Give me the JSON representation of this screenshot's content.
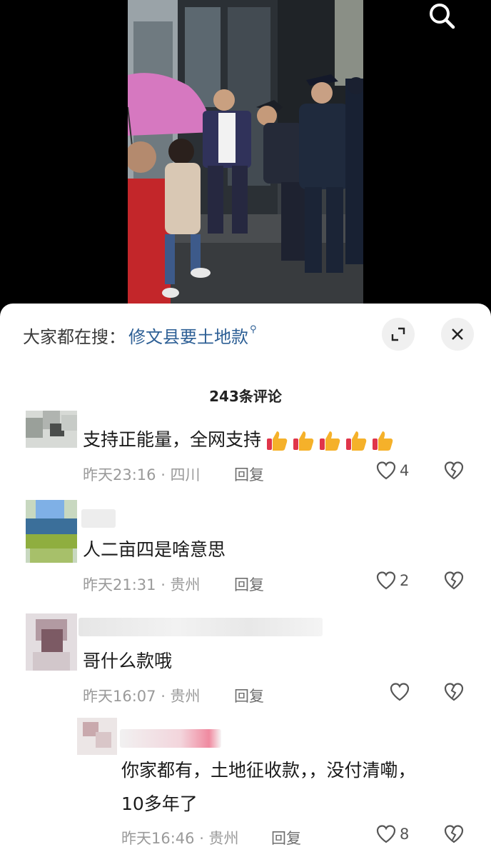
{
  "header": {
    "search_icon": "search-icon"
  },
  "sheet": {
    "search_hint_prefix": "大家都在搜：",
    "search_hint_query": "修文县要土地款",
    "expand_icon": "expand-icon",
    "close_icon": "close-icon",
    "comment_count": "243条评论"
  },
  "comments": [
    {
      "text": "支持正能量，全网支持",
      "emoji": [
        "thumbs-up",
        "thumbs-up",
        "thumbs-up",
        "thumbs-up",
        "thumbs-up"
      ],
      "time": "昨天23:16 · 四川",
      "reply_label": "回复",
      "likes": "4"
    },
    {
      "text": "人二亩四是啥意思",
      "time": "昨天21:31 · 贵州",
      "reply_label": "回复",
      "likes": "2"
    },
    {
      "text": "哥什么款哦",
      "time": "昨天16:07 · 贵州",
      "reply_label": "回复",
      "likes": ""
    }
  ],
  "reply": {
    "text_line1": "你家都有，土地征收款，，没付清嘞，",
    "text_line2": "10多年了",
    "time": "昨天16:46 · 贵州",
    "reply_label": "回复",
    "likes": "8"
  },
  "colors": {
    "link": "#2d5f95",
    "meta": "#9a9a9a",
    "umbrella": "#d678c0",
    "police_uniform": "#1f2a3d"
  }
}
